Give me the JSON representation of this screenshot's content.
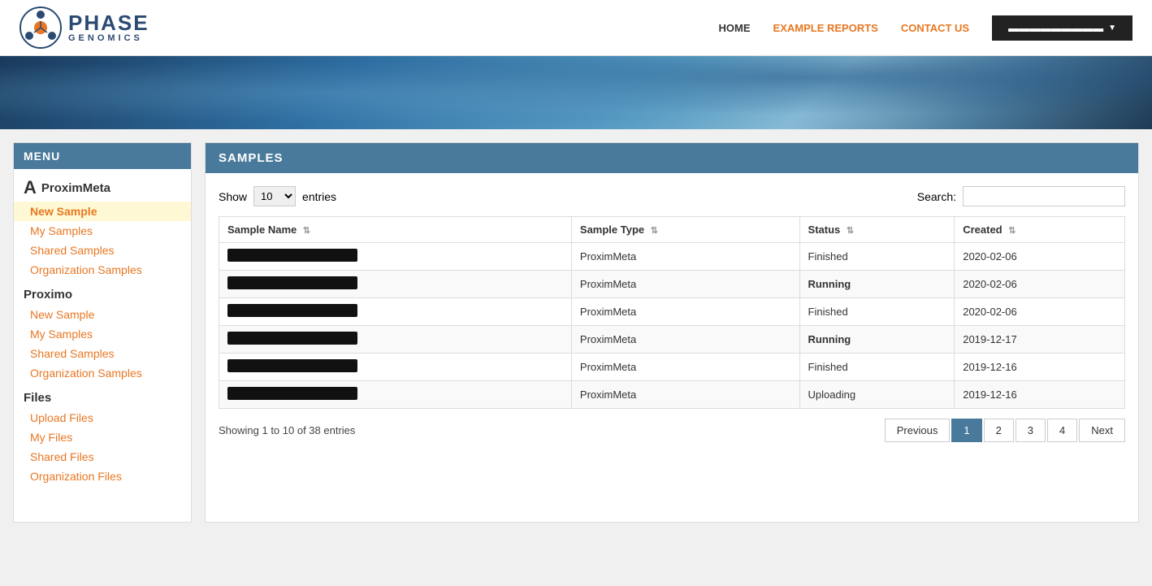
{
  "header": {
    "logo_phase": "PHASE",
    "logo_genomics": "GENOMICS",
    "nav": {
      "home": "HOME",
      "example_reports": "EXAMPLE REPORTS",
      "contact_us": "CONTACT US",
      "user_btn": "▬▬▬▬▬▬▬▬▬"
    }
  },
  "sidebar": {
    "menu_title": "MENU",
    "sections": [
      {
        "title": "ProximMeta",
        "links": [
          {
            "label": "New Sample",
            "active": true
          },
          {
            "label": "My Samples",
            "active": false
          },
          {
            "label": "Shared Samples",
            "active": false
          },
          {
            "label": "Organization Samples",
            "active": false
          }
        ]
      },
      {
        "title": "Proximo",
        "links": [
          {
            "label": "New Sample",
            "active": false
          },
          {
            "label": "My Samples",
            "active": false
          },
          {
            "label": "Shared Samples",
            "active": false
          },
          {
            "label": "Organization Samples",
            "active": false
          }
        ]
      },
      {
        "title": "Files",
        "links": [
          {
            "label": "Upload Files",
            "active": false
          },
          {
            "label": "My Files",
            "active": false
          },
          {
            "label": "Shared Files",
            "active": false
          },
          {
            "label": "Organization Files",
            "active": false
          }
        ]
      }
    ]
  },
  "content": {
    "title": "SAMPLES",
    "show_label": "Show",
    "entries_label": "entries",
    "show_value": "10",
    "search_label": "Search:",
    "search_placeholder": "",
    "columns": [
      "Sample Name",
      "Sample Type",
      "Status",
      "Created"
    ],
    "rows": [
      {
        "name_redacted": true,
        "type": "ProximMeta",
        "status": "Finished",
        "created": "2020-02-06",
        "status_class": "status-finished"
      },
      {
        "name_redacted": true,
        "type": "ProximMeta",
        "status": "Running",
        "created": "2020-02-06",
        "status_class": "status-running"
      },
      {
        "name_redacted": true,
        "type": "ProximMeta",
        "status": "Finished",
        "created": "2020-02-06",
        "status_class": "status-finished"
      },
      {
        "name_redacted": true,
        "type": "ProximMeta",
        "status": "Running",
        "created": "2019-12-17",
        "status_class": "status-running"
      },
      {
        "name_redacted": true,
        "type": "ProximMeta",
        "status": "Finished",
        "created": "2019-12-16",
        "status_class": "status-finished"
      },
      {
        "name_redacted": true,
        "type": "ProximMeta",
        "status": "Uploading",
        "created": "2019-12-16",
        "status_class": "status-uploading"
      }
    ],
    "showing_text": "Showing 1 to 10 of 38 entries",
    "pagination": {
      "previous": "Previous",
      "next": "Next",
      "pages": [
        "1",
        "2",
        "3",
        "4"
      ],
      "active_page": "1"
    }
  }
}
